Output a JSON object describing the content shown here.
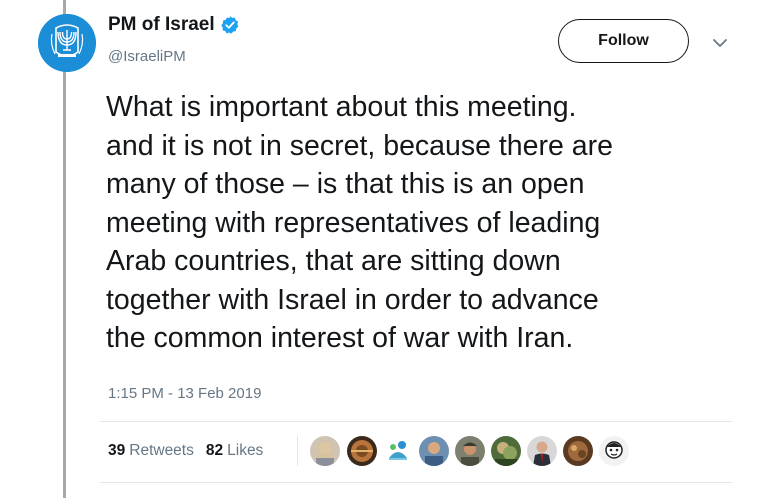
{
  "account": {
    "display_name": "PM of Israel",
    "handle": "@IsraeliPM",
    "verified": true,
    "avatar_icon": "menorah-emblem-icon",
    "avatar_color": "#1c8ed8"
  },
  "actions": {
    "follow_label": "Follow",
    "more_icon": "chevron-down-icon"
  },
  "tweet": {
    "text_lines": [
      "What is important about this meeting.",
      "and it is not in secret, because there are",
      "many of those – is that this is an open",
      "meeting with representatives of leading",
      "Arab countries, that are sitting down",
      "together with Israel in order to advance",
      "the common interest of war with Iran."
    ],
    "timestamp": "1:15 PM - 13 Feb 2019"
  },
  "stats": {
    "retweets_count": "39",
    "retweets_label": "Retweets",
    "likes_count": "82",
    "likes_label": "Likes"
  },
  "colors": {
    "verified_blue": "#1da1f2",
    "secondary_text": "#657786",
    "primary_text": "#14171a"
  }
}
